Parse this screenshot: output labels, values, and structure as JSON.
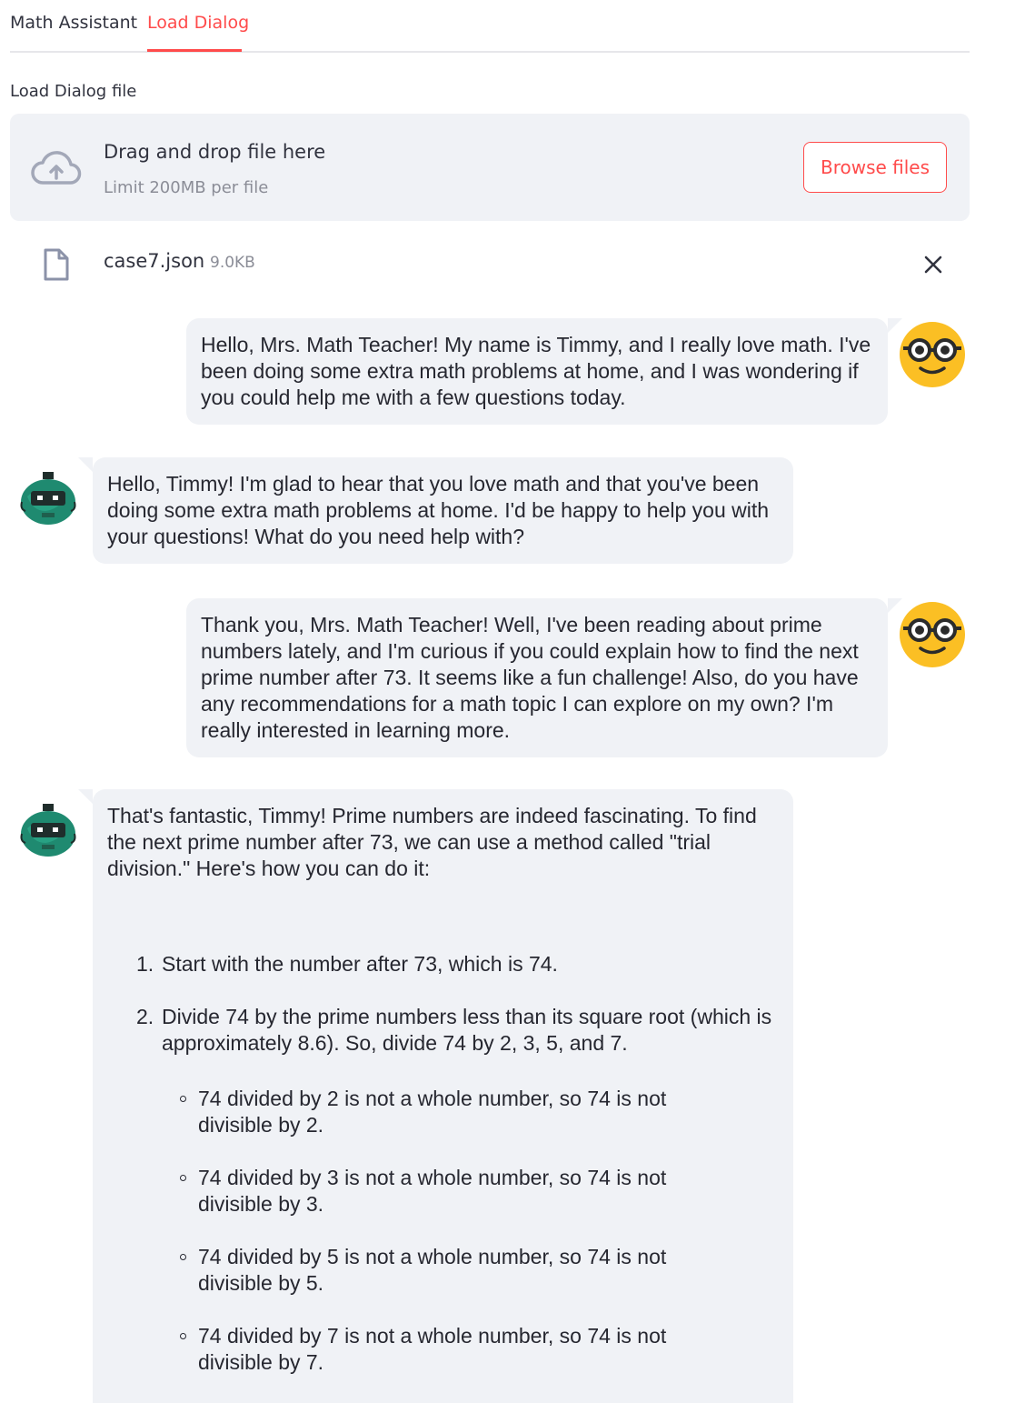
{
  "tabs": [
    {
      "label": "Math Assistant",
      "active": false
    },
    {
      "label": "Load Dialog",
      "active": true
    }
  ],
  "uploader": {
    "label": "Load Dialog file",
    "drop_text": "Drag and drop file here",
    "limit_text": "Limit 200MB per file",
    "browse_label": "Browse files",
    "icon": "cloud-upload-icon"
  },
  "file": {
    "name": "case7.json",
    "size": "9.0KB",
    "icon": "file-icon",
    "remove_icon": "close-icon"
  },
  "messages": [
    {
      "role": "user",
      "avatar": "nerd-face-icon",
      "text": "Hello, Mrs. Math Teacher! My name is Timmy, and I really love math. I've been doing some extra math problems at home, and I was wondering if you could help me with a few questions today."
    },
    {
      "role": "assistant",
      "avatar": "robot-icon",
      "text": "Hello, Timmy! I'm glad to hear that you love math and that you've been doing some extra math problems at home. I'd be happy to help you with your questions! What do you need help with?"
    },
    {
      "role": "user",
      "avatar": "nerd-face-icon",
      "text": "Thank you, Mrs. Math Teacher! Well, I've been reading about prime numbers lately, and I'm curious if you could explain how to find the next prime number after 73. It seems like a fun challenge! Also, do you have any recommendations for a math topic I can explore on my own? I'm really interested in learning more."
    },
    {
      "role": "assistant",
      "avatar": "robot-icon",
      "intro": "That's fantastic, Timmy! Prime numbers are indeed fascinating. To find the next prime number after 73, we can use a method called \"trial division.\" Here's how you can do it:",
      "steps": [
        {
          "num": "1.",
          "text": "Start with the number after 73, which is 74."
        },
        {
          "num": "2.",
          "text": "Divide 74 by the prime numbers less than its square root (which is approximately 8.6). So, divide 74 by 2, 3, 5, and 7."
        }
      ],
      "substeps": [
        "74 divided by 2 is not a whole number, so 74 is not divisible by 2.",
        "74 divided by 3 is not a whole number, so 74 is not divisible by 3.",
        "74 divided by 5 is not a whole number, so 74 is not divisible by 5.",
        "74 divided by 7 is not a whole number, so 74 is not divisible by 7."
      ]
    }
  ],
  "colors": {
    "accent": "#ff4b4b",
    "bubble_bg": "#f0f2f6",
    "text": "#262730",
    "muted": "#8b8d97",
    "user_avatar": "#fbbf24",
    "bot_avatar": "#1f8a70"
  }
}
